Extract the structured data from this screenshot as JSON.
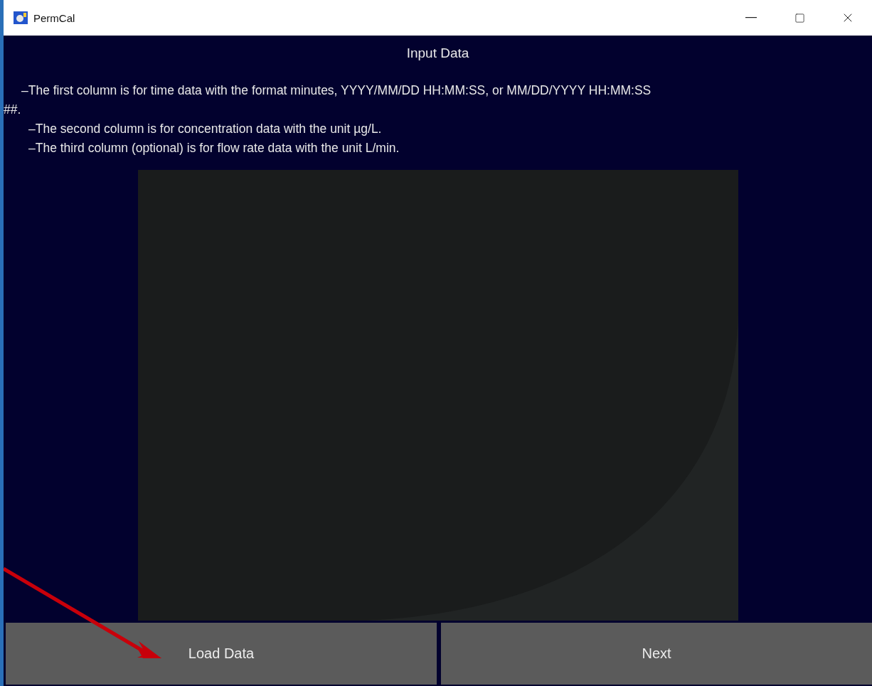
{
  "window": {
    "title": "PermCal"
  },
  "heading": "Input Data",
  "instructions": [
    {
      "text": "–The first column is for time data with the format minutes, YYYY/MM/DD HH:MM:SS, or MM/DD/YYYY HH:MM:SS",
      "continuation": "##."
    },
    {
      "text": "–The second column is for concentration data with the unit µg/L."
    },
    {
      "text": "–The third column (optional) is for flow rate data with the unit L/min."
    }
  ],
  "buttons": [
    {
      "label": "Load Data"
    },
    {
      "label": "Next"
    }
  ]
}
